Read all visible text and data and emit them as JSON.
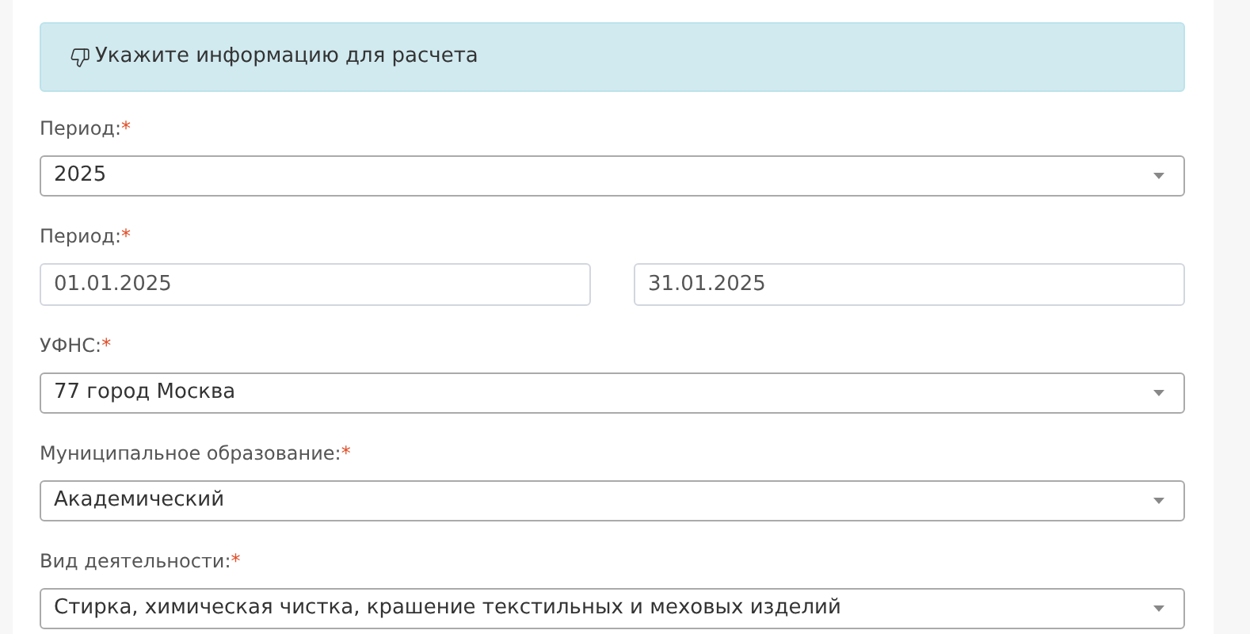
{
  "alert": {
    "text": "Укажите информацию для расчета"
  },
  "fields": [
    {
      "kind": "select",
      "label": "Период:",
      "required_mark": "*",
      "value": "2025"
    },
    {
      "kind": "daterange",
      "label": "Период:",
      "required_mark": "*",
      "from": "01.01.2025",
      "to": "31.01.2025"
    },
    {
      "kind": "select",
      "label": "УФНС:",
      "required_mark": "*",
      "value": "77 город Москва"
    },
    {
      "kind": "select",
      "label": "Муниципальное образование:",
      "required_mark": "*",
      "value": "Академический"
    },
    {
      "kind": "select",
      "label": "Вид деятельности:",
      "required_mark": "*",
      "value": "Стирка, химическая чистка, крашение текстильных и меховых изделий"
    }
  ]
}
